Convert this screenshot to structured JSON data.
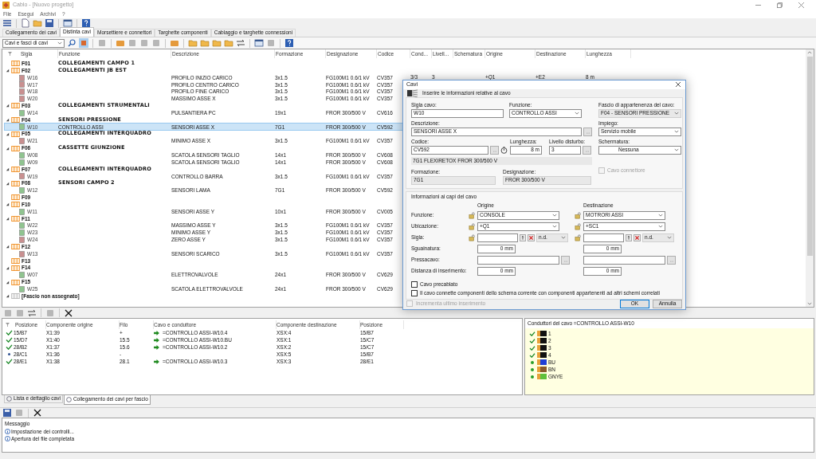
{
  "window": {
    "title": "Cablo - [Nuovo progetto]"
  },
  "menu": [
    "File",
    "Esegui",
    "Archivi",
    "?"
  ],
  "tabs": [
    {
      "label": "Collegamento dei cavi",
      "selected": false
    },
    {
      "label": "Distinta cavi",
      "selected": true
    },
    {
      "label": "Morsettiere e connettori",
      "selected": false
    },
    {
      "label": "Targhette componenti",
      "selected": false
    },
    {
      "label": "Cablaggio e targhette connessioni",
      "selected": false
    }
  ],
  "view_select": {
    "value": "Cavi e fasci di cavi"
  },
  "table": {
    "columns": [
      "Sigla",
      "Funzione",
      "Descrizione",
      "Formazione",
      "Designazione",
      "Codice",
      "Cond...",
      "Livell...",
      "Schematura",
      "Origine",
      "Destinazione",
      "Lunghezza"
    ],
    "groups": [
      {
        "sigla": "F01",
        "funzione": "COLLEGAMENTI CAMPO 1",
        "kind": "bundle",
        "expanded": false
      },
      {
        "sigla": "F02",
        "funzione": "COLLEGAMENTI JB EST",
        "kind": "bundle",
        "expanded": true,
        "children": [
          {
            "sigla": "W16",
            "descrizione": "PROFILO INIZIO CARICO",
            "formazione": "3x1.5",
            "designazione": "FG100M1 0.6/1 kV",
            "codice": "CV357",
            "cond": "3/3",
            "livello": "3",
            "origine": "+Q1",
            "destinazione": "+E2",
            "lunghezza": "8 m",
            "color": "#c99090",
            "selected": false
          },
          {
            "sigla": "W17",
            "descrizione": "PROFILO CENTRO CARICO",
            "formazione": "3x1.5",
            "designazione": "FG100M1 0.6/1 kV",
            "codice": "CV357",
            "color": "#c99090",
            "selected": false
          },
          {
            "sigla": "W18",
            "descrizione": "PROFILO FINE CARICO",
            "formazione": "3x1.5",
            "designazione": "FG100M1 0.6/1 kV",
            "codice": "CV357",
            "color": "#c99090",
            "selected": false
          },
          {
            "sigla": "W20",
            "descrizione": "MASSIMO ASSE X",
            "formazione": "3x1.5",
            "designazione": "FG100M1 0.6/1 kV",
            "codice": "CV357",
            "color": "#c99090",
            "selected": false
          }
        ]
      },
      {
        "sigla": "F03",
        "funzione": "COLLEGAMENTI STRUMENTALI",
        "kind": "bundle",
        "expanded": true,
        "children": [
          {
            "sigla": "W14",
            "descrizione": "PULSANTIERA PC",
            "formazione": "19x1",
            "designazione": "FROR 300/500 V",
            "codice": "CV616",
            "color": "#90c490",
            "selected": false
          }
        ]
      },
      {
        "sigla": "F04",
        "funzione": "SENSORI PRESSIONE",
        "kind": "bundle",
        "expanded": true,
        "children": [
          {
            "sigla": "W10",
            "funzione": "CONTROLLO ASSI",
            "descrizione": "SENSORI ASSE X",
            "formazione": "7G1",
            "designazione": "FROR 300/500 V",
            "codice": "CV592",
            "color": "#90c490",
            "selected": true
          }
        ]
      },
      {
        "sigla": "F05",
        "funzione": "COLLEGAMENTI INTERQUADRO",
        "kind": "bundle",
        "expanded": true,
        "children": [
          {
            "sigla": "W21",
            "descrizione": "MINIMO ASSE X",
            "formazione": "3x1.5",
            "designazione": "FG100M1 0.6/1 kV",
            "codice": "CV357",
            "color": "#c99090",
            "selected": false
          }
        ]
      },
      {
        "sigla": "F06",
        "funzione": "CASSETTE GIUNZIONE",
        "kind": "bundle",
        "expanded": true,
        "children": [
          {
            "sigla": "W08",
            "descrizione": "SCATOLA SENSORI TAGLIO",
            "formazione": "14x1",
            "designazione": "FROR 300/500 V",
            "codice": "CV608",
            "color": "#90c490",
            "selected": false
          },
          {
            "sigla": "W09",
            "descrizione": "SCATOLA SENSORI TAGLIO",
            "formazione": "14x1",
            "designazione": "FROR 300/500 V",
            "codice": "CV608",
            "color": "#90c490",
            "selected": false
          }
        ]
      },
      {
        "sigla": "F07",
        "funzione": "COLLEGAMENTI INTERQUADRO",
        "kind": "bundle",
        "expanded": true,
        "children": [
          {
            "sigla": "W19",
            "descrizione": "CONTROLLO BARRA",
            "formazione": "3x1.5",
            "designazione": "FG100M1 0.6/1 kV",
            "codice": "CV357",
            "color": "#c99090",
            "selected": false
          }
        ]
      },
      {
        "sigla": "F08",
        "funzione": "SENSORI CAMPO 2",
        "kind": "bundle",
        "expanded": true,
        "children": [
          {
            "sigla": "W12",
            "descrizione": "SENSORI LAMA",
            "formazione": "7G1",
            "designazione": "FROR 300/500 V",
            "codice": "CV592",
            "color": "#90c490",
            "selected": false
          }
        ]
      },
      {
        "sigla": "F09",
        "kind": "bundle",
        "expanded": false
      },
      {
        "sigla": "F10",
        "kind": "bundle",
        "expanded": true,
        "children": [
          {
            "sigla": "W11",
            "descrizione": "SENSORI ASSE Y",
            "formazione": "10x1",
            "designazione": "FROR 300/500 V",
            "codice": "CV005",
            "color": "#90c490",
            "selected": false
          }
        ]
      },
      {
        "sigla": "F11",
        "kind": "bundle",
        "expanded": true,
        "children": [
          {
            "sigla": "W22",
            "descrizione": "MASSIMO ASSE Y",
            "formazione": "3x1.5",
            "designazione": "FG100M1 0.6/1 kV",
            "codice": "CV357",
            "color": "#90c490",
            "selected": false
          },
          {
            "sigla": "W23",
            "descrizione": "MINIMO ASSE Y",
            "formazione": "3x1.5",
            "designazione": "FG100M1 0.6/1 kV",
            "codice": "CV357",
            "color": "#90c490",
            "selected": false
          },
          {
            "sigla": "W24",
            "descrizione": "ZERO ASSE Y",
            "formazione": "3x1.5",
            "designazione": "FG100M1 0.6/1 kV",
            "codice": "CV357",
            "color": "#c99090",
            "selected": false
          }
        ]
      },
      {
        "sigla": "F12",
        "kind": "bundle",
        "expanded": true,
        "children": [
          {
            "sigla": "W13",
            "descrizione": "SENSORI SCARICO",
            "formazione": "3x1.5",
            "designazione": "FG100M1 0.6/1 kV",
            "codice": "CV357",
            "color": "#c99090",
            "selected": false
          }
        ]
      },
      {
        "sigla": "F13",
        "kind": "bundle",
        "expanded": false
      },
      {
        "sigla": "F14",
        "kind": "bundle",
        "expanded": true,
        "children": [
          {
            "sigla": "W07",
            "descrizione": "ELETTROVALVOLE",
            "formazione": "24x1",
            "designazione": "FROR 300/500 V",
            "codice": "CV629",
            "color": "#90c490",
            "selected": false
          }
        ]
      },
      {
        "sigla": "F15",
        "kind": "bundle",
        "expanded": true,
        "children": [
          {
            "sigla": "W25",
            "descrizione": "SCATOLA ELETTROVALVOLE",
            "formazione": "24x1",
            "designazione": "FROR 300/500 V",
            "codice": "CV629",
            "color": "#90c490",
            "selected": false
          }
        ]
      },
      {
        "sigla": "[Fascio non assegnato]",
        "kind": "unassigned",
        "expanded": true
      }
    ]
  },
  "connections": {
    "columns": [
      "Posizione",
      "Componente origine",
      "Filo",
      "Cavo e conduttore",
      "Componente destinazione",
      "Posizione"
    ],
    "rows": [
      {
        "kind": "connected",
        "posizione": "15/B7",
        "origine": "X1:39",
        "filo": "+",
        "cavo": "=CONTROLLO ASSI-W10.4",
        "destinazione": "XSX:4",
        "posizione_dest": "15/B7"
      },
      {
        "kind": "connected",
        "posizione": "15/D7",
        "origine": "X1:40",
        "filo": "15.5",
        "cavo": "=CONTROLLO ASSI-W10.BU",
        "destinazione": "XSX:1",
        "posizione_dest": "15/C7"
      },
      {
        "kind": "connected",
        "posizione": "28/B2",
        "origine": "X1:37",
        "filo": "15.6",
        "cavo": "=CONTROLLO ASSI-W10.2",
        "destinazione": "XSX:2",
        "posizione_dest": "15/C7"
      },
      {
        "kind": "pending",
        "posizione": "28/C1",
        "origine": "X1:36",
        "filo": "-",
        "destinazione": "XSX:5",
        "posizione_dest": "15/B7"
      },
      {
        "kind": "connected",
        "posizione": "28/E1",
        "origine": "X1:38",
        "filo": "28.1",
        "cavo": "=CONTROLLO ASSI-W10.3",
        "destinazione": "XSX:3",
        "posizione_dest": "28/E1"
      }
    ]
  },
  "conductors": {
    "title": "Conduttori del cavo =CONTROLLO ASSI-W10",
    "items": [
      {
        "label": "1",
        "kind": "connected",
        "color": "#111111"
      },
      {
        "label": "2",
        "kind": "connected",
        "color": "#111111"
      },
      {
        "label": "3",
        "kind": "connected",
        "color": "#111111"
      },
      {
        "label": "4",
        "kind": "connected",
        "color": "#111111"
      },
      {
        "label": "BU",
        "kind": "free",
        "color": "#1f3fd6"
      },
      {
        "label": "BN",
        "kind": "free",
        "color": "#8a5a2b"
      },
      {
        "label": "GNYE",
        "kind": "free",
        "color": "#5fc03c"
      }
    ]
  },
  "bottom_tabs": [
    {
      "label": "Lista e dettaglio cavi",
      "selected": false
    },
    {
      "label": "Collegamento dei cavi per fascio",
      "selected": true
    }
  ],
  "messages": {
    "title": "Messaggio",
    "items": [
      "Impostazione dei controlli...",
      "Apertura del file completata"
    ]
  },
  "dialog": {
    "title": "Cavi",
    "header": "Inserire le informazioni relative al cavo",
    "sigla": {
      "label": "Sigla cavo:",
      "value": "W10"
    },
    "funzione": {
      "label": "Funzione:",
      "value": "CONTROLLO ASSI"
    },
    "fascio": {
      "label": "Fascio di appartenenza del cavo:",
      "value": "F04 - SENSORI PRESSIONE",
      "disabled": true
    },
    "descrizione": {
      "label": "Descrizione:",
      "value": "SENSORI ASSE X"
    },
    "impiego": {
      "label": "Impiego:",
      "value": "Servizio mobile"
    },
    "codice": {
      "label": "Codice:",
      "value": "CV592",
      "description": "7G1 FLEXIRETOX FROR 300/500 V"
    },
    "lunghezza": {
      "label": "Lunghezza:",
      "value": "8 m"
    },
    "livello": {
      "label": "Livello disturbo:",
      "value": "3"
    },
    "schermatura": {
      "label": "Schermatura:",
      "value": "Nessuna"
    },
    "formazione": {
      "label": "Formazione:",
      "value": "7G1"
    },
    "designazione": {
      "label": "Designazione:",
      "value": "FROR 300/500 V"
    },
    "cavo_connettore": {
      "label": "Cavo connettore",
      "checked": false,
      "disabled": true
    },
    "ends": {
      "title": "Informazioni ai capi del cavo",
      "columns": [
        "Origine",
        "Destinazione"
      ],
      "labels": [
        "Funzione:",
        "Ubicazione:",
        "Sigla:",
        "Sguainatura:",
        "Pressacavo:",
        "Distanza di inserimento:"
      ],
      "sides": [
        {
          "funzione": "CONSOLE",
          "ubicazione": "+Q1",
          "sigla_type": "n.d.",
          "sguainatura": "0 mm",
          "distanza": "0 mm"
        },
        {
          "funzione": "MOTRORI ASSI",
          "ubicazione": "+SC1",
          "sigla_type": "n.d.",
          "sguainatura": "0 mm",
          "distanza": "0 mm"
        }
      ]
    },
    "options": [
      {
        "label": "Cavo precablato",
        "checked": false
      },
      {
        "label": "Il cavo connette componenti dello schema corrente con componenti appartenenti ad altri schemi correlati",
        "checked": false
      }
    ],
    "increment": {
      "label": "Incrementa ultimo inserimento",
      "checked": false,
      "disabled": true
    },
    "buttons": [
      {
        "label": "OK",
        "default": true
      },
      {
        "label": "Annulla",
        "default": false
      }
    ]
  }
}
